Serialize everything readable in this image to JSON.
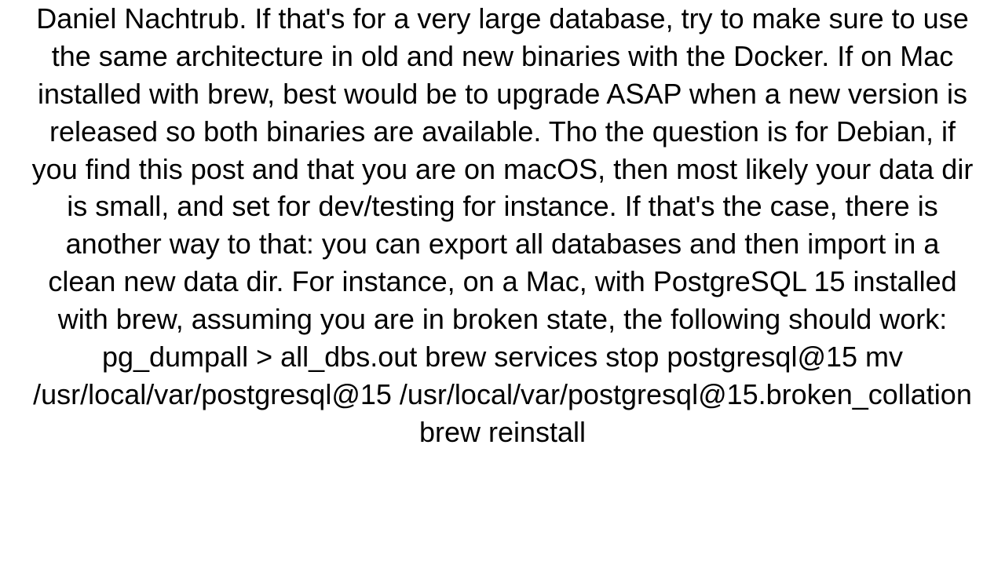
{
  "document": {
    "body_text": "Daniel Nachtrub. If that's for a very large database, try to make sure to use the same architecture in old and new binaries with the Docker. If on Mac installed with brew, best would be to upgrade ASAP when a new version is released so both binaries are available. Tho the question is for Debian, if you find this post and that you are on macOS, then most likely your data dir is small, and set for dev/testing for instance. If that's the case, there is another way to that: you can export all databases and then import in a clean new data dir. For instance, on a Mac, with PostgreSQL 15 installed with brew, assuming you are in broken state, the following should work: pg_dumpall > all_dbs.out brew services stop postgresql@15 mv /usr/local/var/postgresql@15 /usr/local/var/postgresql@15.broken_collation brew reinstall"
  }
}
